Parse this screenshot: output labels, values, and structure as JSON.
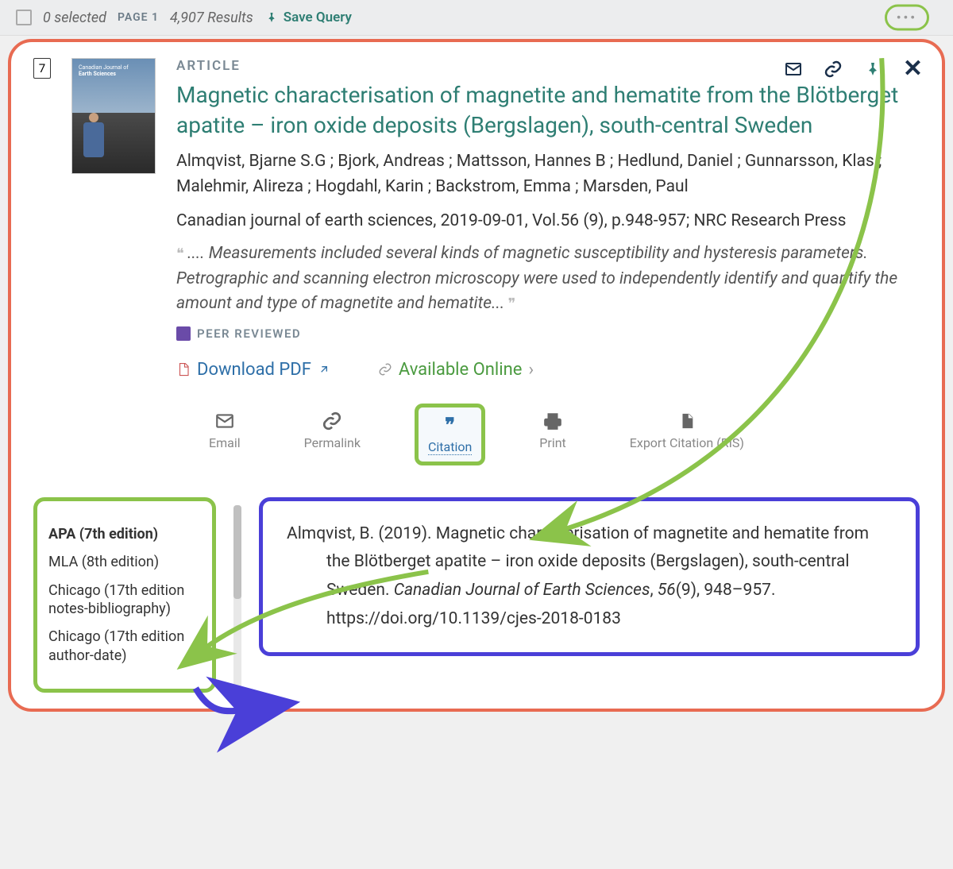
{
  "topbar": {
    "selected": "0 selected",
    "page": "PAGE 1",
    "results": "4,907 Results",
    "save_query": "Save Query"
  },
  "result": {
    "number": "7",
    "type": "ARTICLE",
    "title": "Magnetic characterisation of magnetite and hematite from the Blötberget apatite – iron oxide deposits (Bergslagen), south-central Sweden",
    "authors": "Almqvist, Bjarne S.G ; Bjork, Andreas ; Mattsson, Hannes B ; Hedlund, Daniel ; Gunnarsson, Klas ; Malehmir, Alireza ; Hogdahl, Karin ; Backstrom, Emma ; Marsden, Paul",
    "source": "Canadian journal of earth sciences, 2019-09-01, Vol.56 (9), p.948-957; NRC Research Press",
    "abstract": ".... Measurements included several kinds of magnetic susceptibility and hysteresis parameters. Petrographic and scanning electron microscopy were used to independently identify and quantify the amount and type of magnetite and hematite...",
    "peer_reviewed": "PEER REVIEWED",
    "download_pdf": "Download PDF",
    "available_online": "Available Online"
  },
  "actions": {
    "email": "Email",
    "permalink": "Permalink",
    "citation": "Citation",
    "print": "Print",
    "export": "Export Citation (RIS)"
  },
  "citation_styles": {
    "apa": "APA (7th edition)",
    "mla": "MLA (8th edition)",
    "chi_nb": "Chicago (17th edition notes-bibliography)",
    "chi_ad": "Chicago (17th edition author-date)"
  },
  "citation_text": {
    "pre": "Almqvist, B. (2019). Magnetic characterisation of magnetite and hematite from the Blötberget apatite – iron oxide deposits (Bergslagen), south-central Sweden. ",
    "journal": "Canadian Journal of Earth Sciences",
    "mid": ", ",
    "vol": "56",
    "post": "(9), 948–957. https://doi.org/10.1139/cjes-2018-0183"
  },
  "thumb": {
    "journal": "Canadian Journal of",
    "subject": "Earth Sciences"
  }
}
